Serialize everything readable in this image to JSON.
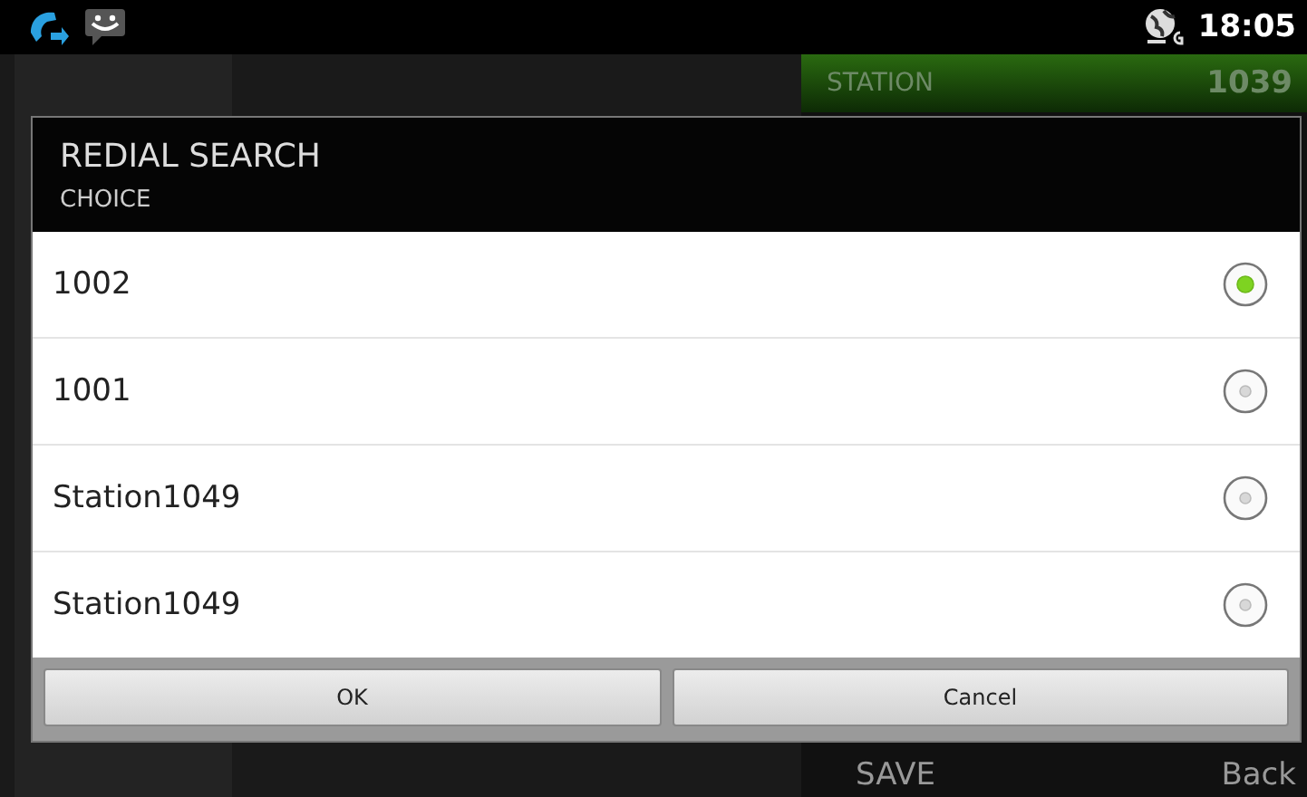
{
  "status_bar": {
    "time": "18:05"
  },
  "background": {
    "station_label": "STATION",
    "station_number": "1039",
    "softkeys": [
      "SAVE",
      "Back"
    ]
  },
  "dialog": {
    "title": "REDIAL SEARCH",
    "subtitle": "CHOICE",
    "options": [
      {
        "label": "1002",
        "selected": true
      },
      {
        "label": "1001",
        "selected": false
      },
      {
        "label": "Station1049",
        "selected": false
      },
      {
        "label": "Station1049",
        "selected": false
      }
    ],
    "buttons": [
      "OK",
      "Cancel"
    ]
  }
}
